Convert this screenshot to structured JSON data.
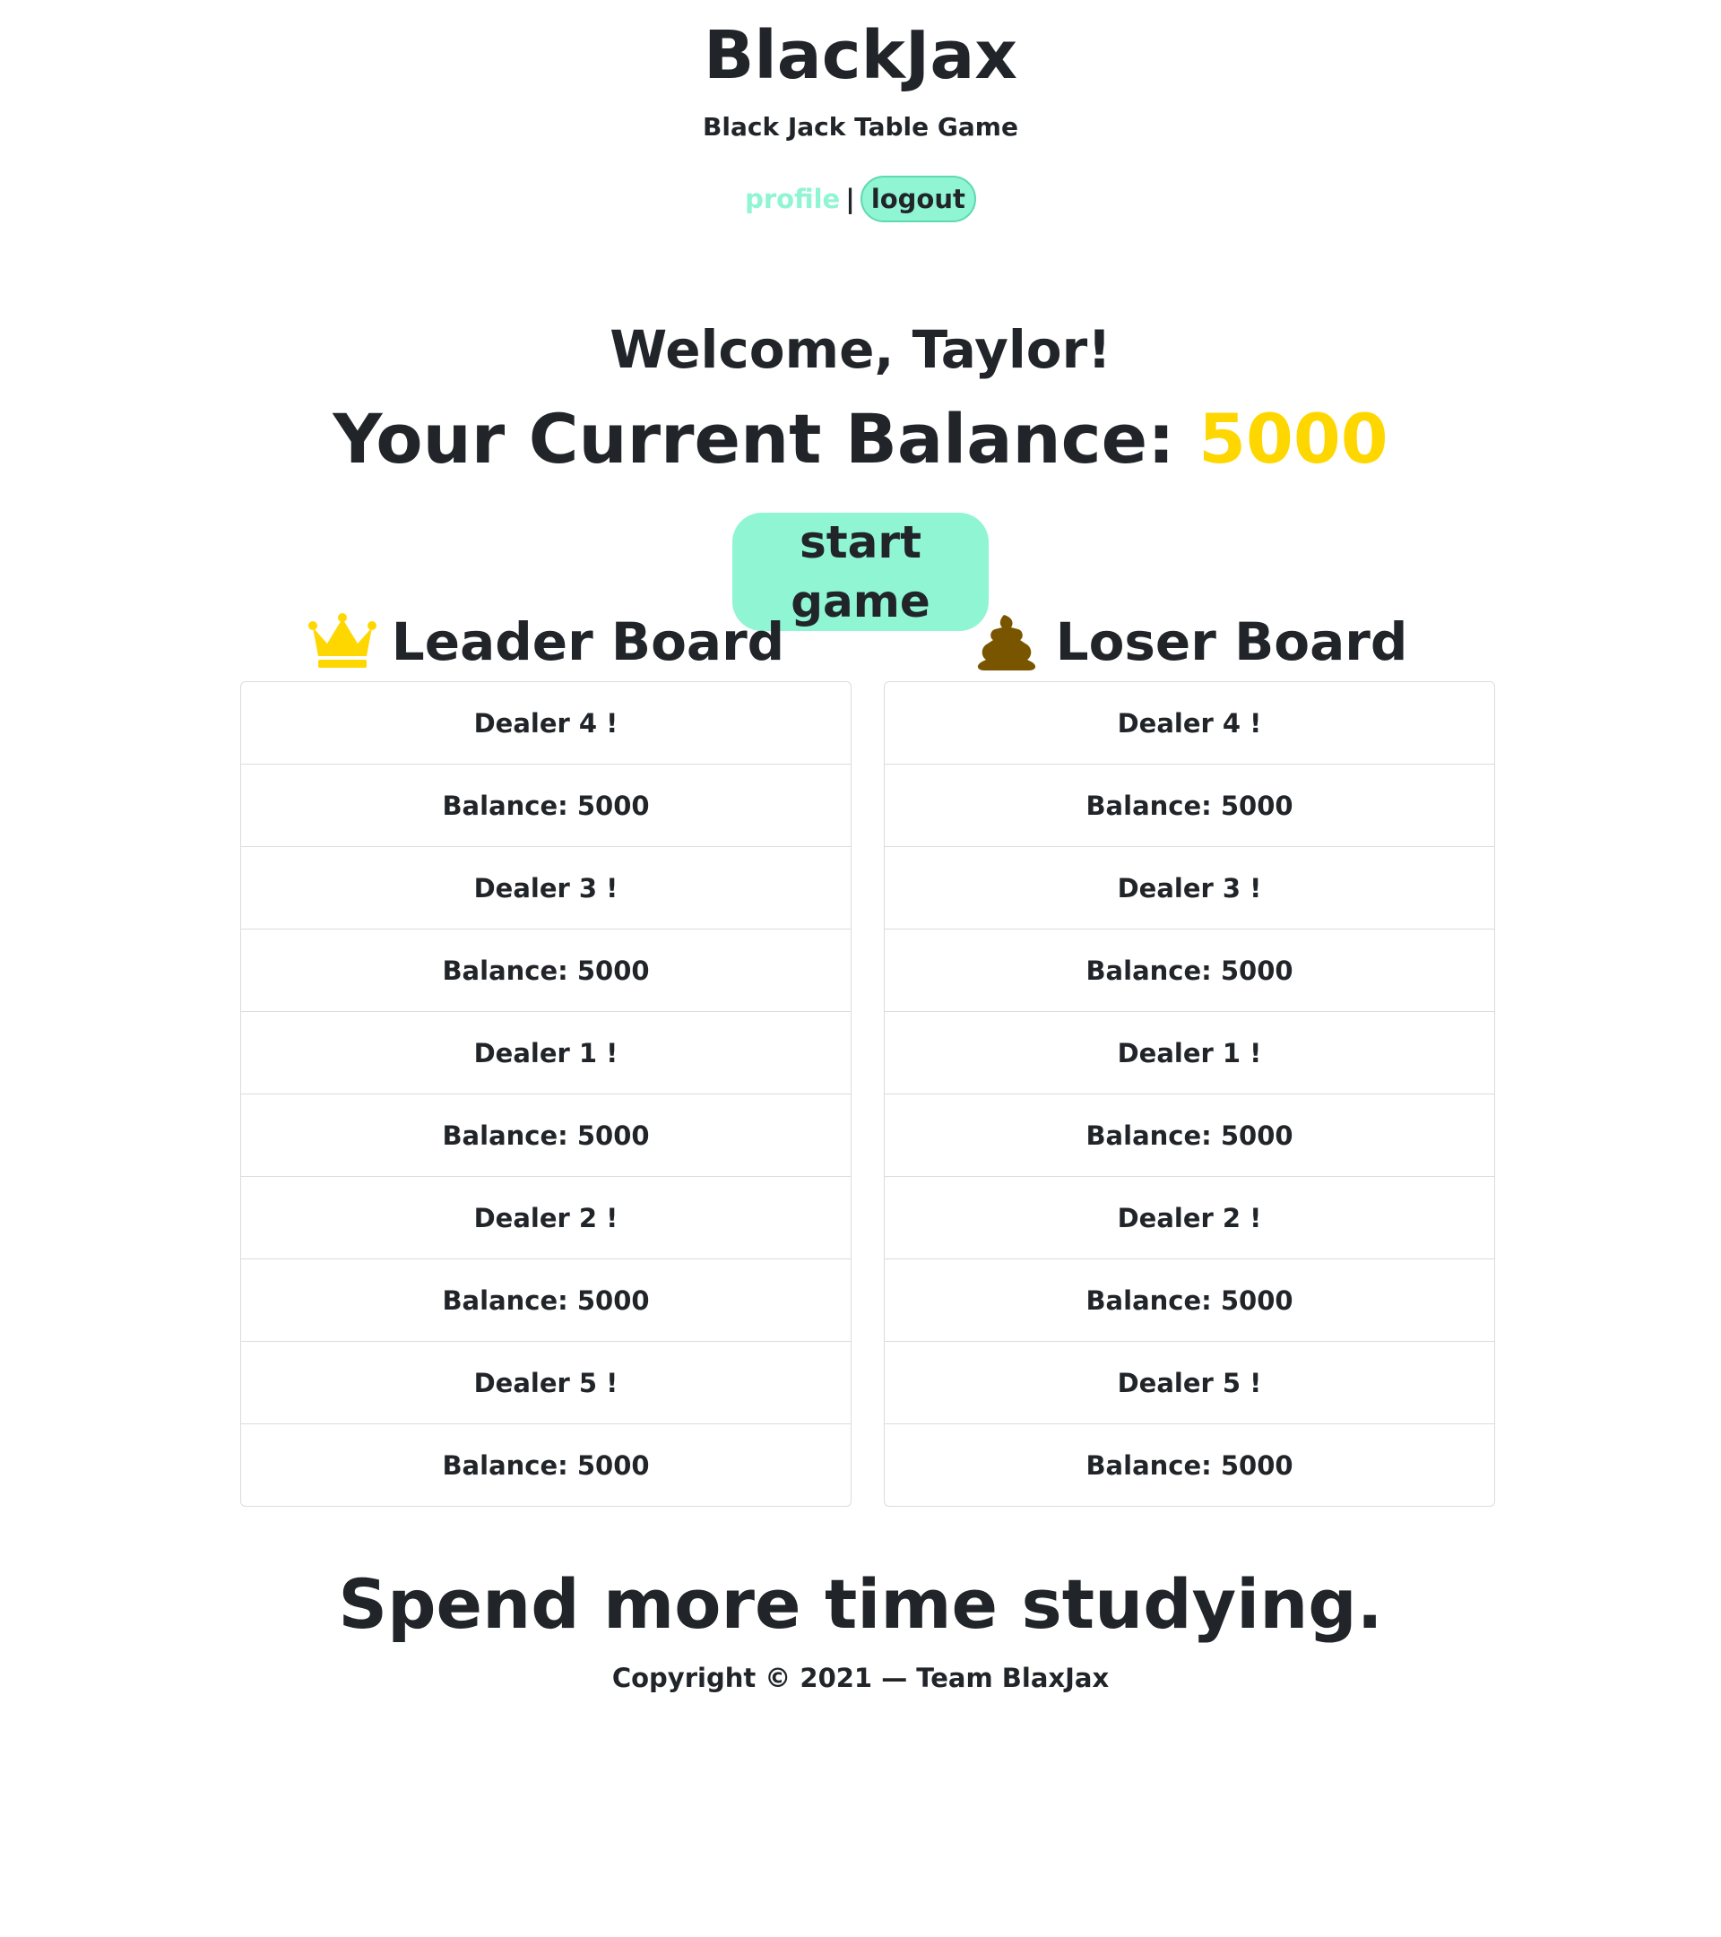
{
  "header": {
    "title": "BlackJax",
    "subtitle": "Black Jack Table Game"
  },
  "nav": {
    "profile_label": "profile",
    "separator": "|",
    "logout_label": "logout"
  },
  "welcome": {
    "greeting": "Welcome, Taylor!",
    "balance_label": "Your Current Balance:",
    "balance_value": "5000"
  },
  "start_button_label": "start game",
  "leader_board": {
    "title": "Leader Board",
    "icon": "crown-icon",
    "items": [
      "Dealer 4 !",
      "Balance: 5000",
      "Dealer 3 !",
      "Balance: 5000",
      "Dealer 1 !",
      "Balance: 5000",
      "Dealer 2 !",
      "Balance: 5000",
      "Dealer 5 !",
      "Balance: 5000"
    ]
  },
  "loser_board": {
    "title": "Loser Board",
    "icon": "poop-icon",
    "items": [
      "Dealer 4 !",
      "Balance: 5000",
      "Dealer 3 !",
      "Balance: 5000",
      "Dealer 1 !",
      "Balance: 5000",
      "Dealer 2 !",
      "Balance: 5000",
      "Dealer 5 !",
      "Balance: 5000"
    ]
  },
  "footer": {
    "tagline": "Spend more time studying.",
    "copyright": "Copyright © 2021 — Team BlaxJax"
  },
  "colors": {
    "accent": "#8ff5d2",
    "gold": "#ffd700",
    "poop": "#7a5500",
    "text": "#212529"
  }
}
